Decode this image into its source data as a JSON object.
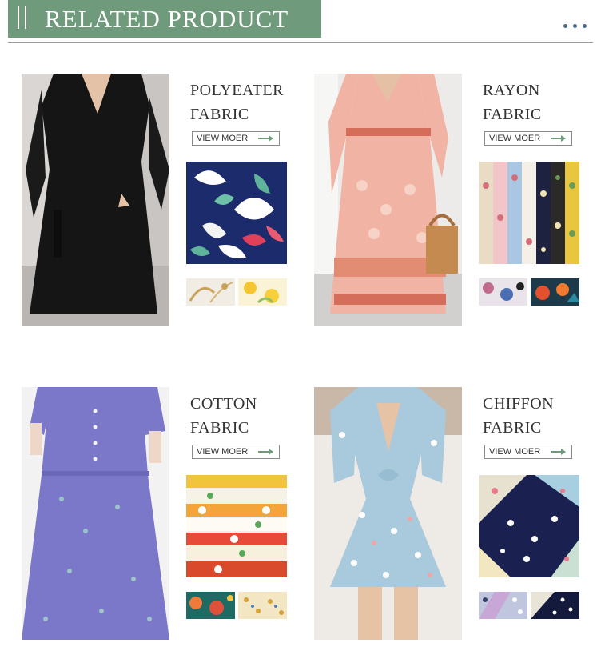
{
  "header": {
    "title": "RELATED PRODUCT",
    "icon": "double-bar-icon",
    "dots_icon": "more-dots-icon",
    "colors": {
      "banner": "#6f9a7c",
      "dots": "#4b6b8a"
    }
  },
  "products": [
    {
      "line1": "POLYEATER",
      "line2": "FABRIC",
      "button": "VIEW MOER"
    },
    {
      "line1": "RAYON",
      "line2": "FABRIC",
      "button": "VIEW MOER"
    },
    {
      "line1": "COTTON",
      "line2": "FABRIC",
      "button": "VIEW MOER"
    },
    {
      "line1": "CHIFFON",
      "line2": "FABRIC",
      "button": "VIEW MOER"
    }
  ]
}
